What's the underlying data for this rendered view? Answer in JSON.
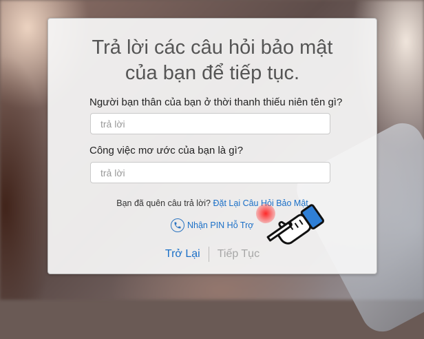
{
  "dialog": {
    "title": "Trả lời các câu hỏi bảo mật của bạn để tiếp tục.",
    "question1": {
      "label": "Người bạn thân của bạn ở thời thanh thiếu niên tên gì?",
      "value": "",
      "placeholder": "trả lời"
    },
    "question2": {
      "label": "Công việc mơ ước của bạn là gì?",
      "value": "",
      "placeholder": "trả lời"
    },
    "forgot": {
      "prompt": "Bạn đã quên câu trả lời?",
      "link": "Đặt Lại Câu Hỏi Bảo Mật"
    },
    "pin": {
      "icon": "phone-icon",
      "label": "Nhận PIN Hỗ Trợ"
    },
    "footer": {
      "back_label": "Trở Lại",
      "continue_label": "Tiếp Tục"
    }
  },
  "colors": {
    "link": "#1a6fc7",
    "disabled": "#a6a6a6",
    "click_highlight": "#ff2020"
  },
  "overlay": {
    "cursor_icon": "hand-pointer-icon"
  }
}
